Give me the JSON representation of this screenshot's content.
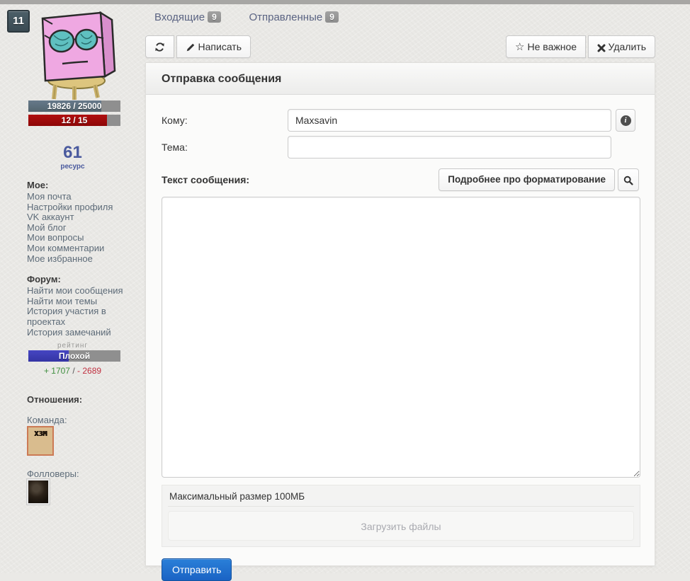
{
  "colors": {
    "accent_blue": "#1b6ec8",
    "tab_link": "#5a6382",
    "exp_fill": "#5d707c",
    "hp_fill": "#a50d0d",
    "rating_fill": "#3d3db5",
    "plus_green": "#3f8f3f",
    "minus_red": "#c03040",
    "badge_gray": "#999999"
  },
  "profile": {
    "level_badge": "11",
    "avatar_alt": "pink-box-character",
    "exp_bar": {
      "label": "19826 / 25000",
      "fill": "79%"
    },
    "hp_bar": {
      "label": "12 / 15",
      "fill": "85%"
    },
    "resource_value": "61",
    "resource_label": "ресурс"
  },
  "sidebar": {
    "sections": [
      {
        "title": "Мое:",
        "items": [
          "Моя почта",
          "Настройки профиля",
          "VK аккаунт",
          "Мой блог",
          "Мои вопросы",
          "Мои комментарии",
          "Мое избранное"
        ]
      },
      {
        "title": "Форум:",
        "items": [
          "Найти мои сообщения",
          "Найти мои темы",
          "История участия в проектах",
          "История замечаний"
        ]
      }
    ],
    "rating": {
      "label": "рейтинг",
      "value": "Плохой",
      "fill": "44%",
      "plus": "+ 1707",
      "separator": "/",
      "minus": "- 2689"
    },
    "relations": {
      "title": "Отношения:",
      "team_label": "Команда:",
      "team_avatar_text": "ХЗМ",
      "followers_label": "Фолловеры:"
    }
  },
  "tabs": [
    {
      "label": "Входящие",
      "badge": "9"
    },
    {
      "label": "Отправленные",
      "badge": "9"
    }
  ],
  "toolbar": {
    "compose": "Написать",
    "not_important": "Не важное",
    "delete": "Удалить",
    "star_glyph": "☆"
  },
  "panel": {
    "title": "Отправка сообщения",
    "to_label": "Кому:",
    "to_value": "Maxsavin",
    "subject_label": "Тема:",
    "subject_value": "",
    "body_label": "Текст сообщения:",
    "formatting_button": "Подробнее про форматирование",
    "upload_hint": "Максимальный размер 100МБ",
    "upload_button": "Загрузить файлы",
    "send_button": "Отправить"
  }
}
